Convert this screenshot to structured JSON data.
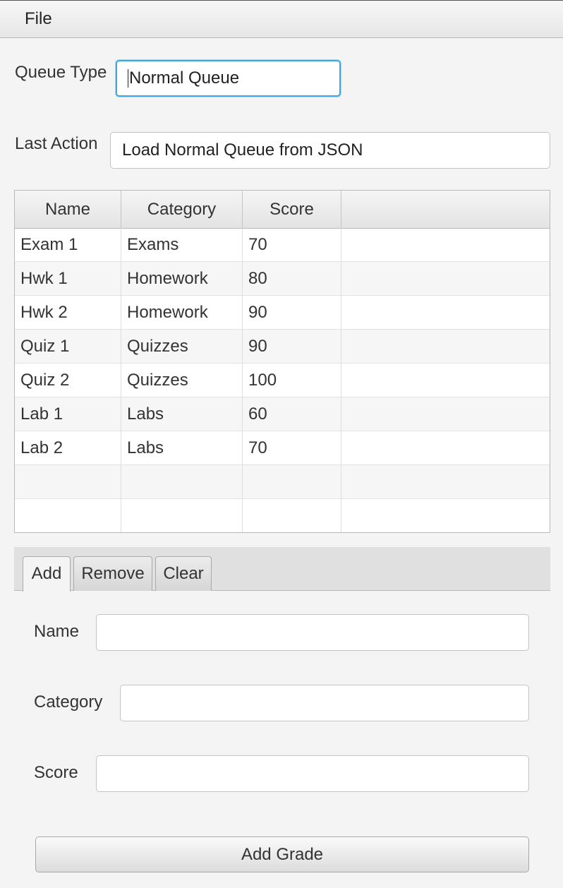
{
  "menu": {
    "file_label": "File"
  },
  "queue_type": {
    "label": "Queue Type",
    "value": "Normal Queue"
  },
  "last_action": {
    "label": "Last Action",
    "value": "Load Normal Queue from JSON"
  },
  "table": {
    "columns": [
      "Name",
      "Category",
      "Score"
    ],
    "rows": [
      [
        "Exam 1",
        "Exams",
        "70"
      ],
      [
        "Hwk 1",
        "Homework",
        "80"
      ],
      [
        "Hwk 2",
        "Homework",
        "90"
      ],
      [
        "Quiz 1",
        "Quizzes",
        "90"
      ],
      [
        "Quiz 2",
        "Quizzes",
        "100"
      ],
      [
        "Lab 1",
        "Labs",
        "60"
      ],
      [
        "Lab 2",
        "Labs",
        "70"
      ]
    ]
  },
  "tabs": [
    {
      "label": "Add",
      "active": true
    },
    {
      "label": "Remove",
      "active": false
    },
    {
      "label": "Clear",
      "active": false
    }
  ],
  "form": {
    "name_label": "Name",
    "name_value": "",
    "category_label": "Category",
    "category_value": "",
    "score_label": "Score",
    "score_value": "",
    "submit_label": "Add Grade"
  }
}
